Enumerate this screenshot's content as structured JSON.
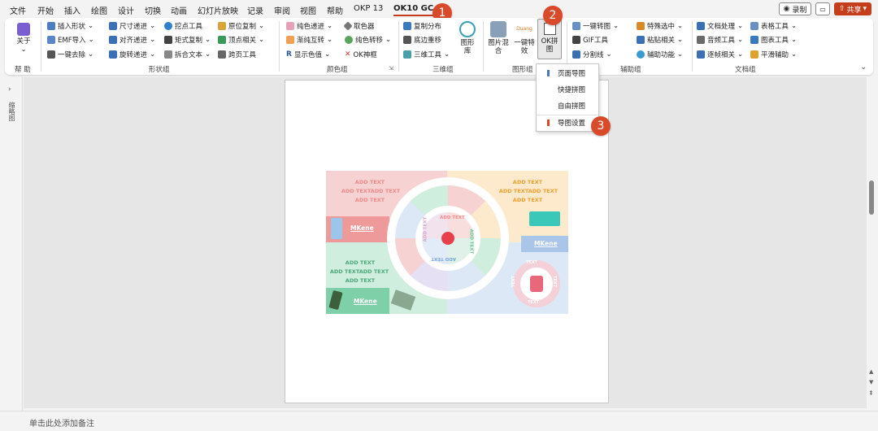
{
  "menu": {
    "items": [
      "文件",
      "开始",
      "插入",
      "绘图",
      "设计",
      "切换",
      "动画",
      "幻灯片放映",
      "记录",
      "审阅",
      "视图",
      "帮助",
      "OKP 13",
      "OK10 GC"
    ],
    "record": "录制",
    "share": "共享"
  },
  "ribbon": {
    "about": {
      "label": "关于",
      "group": "帮 助"
    },
    "shape": {
      "group": "形状组",
      "items": [
        "插入形状",
        "尺寸递进",
        "挖点工具",
        "原位复制",
        "EMF导入",
        "对齐递进",
        "矩式复制",
        "顶点相关",
        "一键去除",
        "旋转递进",
        "拆合文本",
        "跨页工具"
      ]
    },
    "color": {
      "group": "颜色组",
      "items": [
        "纯色递进",
        "取色器",
        "渐纯互转",
        "纯色转移",
        "显示色值",
        "OK神框"
      ]
    },
    "three_d": {
      "group": "三维组",
      "items": [
        "复制分布",
        "底边重移",
        "三维工具"
      ],
      "big": "图形库"
    },
    "graphic": {
      "group": "图形组",
      "big1": "图片混合",
      "big2": "一键特效",
      "big2_hint": "Duang",
      "big3": "OK拼图"
    },
    "aux": {
      "group": "辅助组",
      "items": [
        "一键转图",
        "特殊选中",
        "GIF工具",
        "粘贴相关",
        "分割线",
        "辅助功能"
      ]
    },
    "doc": {
      "group": "文档组",
      "items": [
        "文档处理",
        "表格工具",
        "音频工具",
        "图表工具",
        "逐帧相关",
        "平滑辅助"
      ]
    }
  },
  "dropdown": {
    "items": [
      "页面导图",
      "快捷拼图",
      "自由拼图",
      "导图设置"
    ]
  },
  "badges": [
    "1",
    "2",
    "3"
  ],
  "left_panel": "缩略图",
  "notes": "单击此处添加备注",
  "slide": {
    "add_text": "ADD TEXT",
    "add_text_double": "ADD TEXTADD TEXT",
    "brand": "MKene",
    "ring_labels": [
      "ADD TEXT",
      "ADD TEXT",
      "ADD TEXT",
      "ADD TEXT"
    ],
    "mini_ring": [
      "TEXT",
      "TEXT",
      "TEXT",
      "TEXT"
    ]
  },
  "colors": {
    "accent": "#c43e1c",
    "badge": "#d94a2b",
    "pink": "#f6d2d2",
    "orange": "#fde9cc",
    "green": "#cfeedd",
    "blue": "#dde8f6"
  }
}
